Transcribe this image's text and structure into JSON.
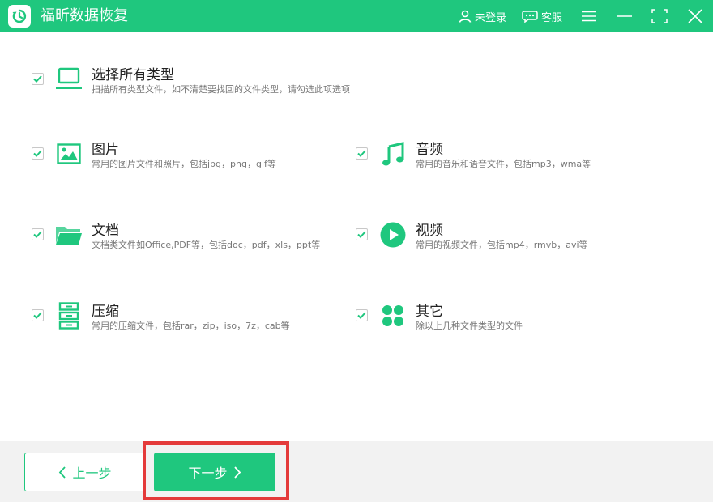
{
  "app": {
    "title": "福昕数据恢复"
  },
  "titlebar": {
    "login_label": "未登录",
    "service_label": "客服"
  },
  "options": {
    "all": {
      "title": "选择所有类型",
      "desc": "扫描所有类型文件，如不清楚要找回的文件类型，请勾选此项选项",
      "checked": true,
      "icon": "laptop-icon"
    },
    "image": {
      "title": "图片",
      "desc": "常用的图片文件和照片，包括jpg，png，gif等",
      "checked": true,
      "icon": "image-icon"
    },
    "audio": {
      "title": "音频",
      "desc": "常用的音乐和语音文件，包括mp3，wma等",
      "checked": true,
      "icon": "music-note-icon"
    },
    "document": {
      "title": "文档",
      "desc": "文档类文件如Office,PDF等，包括doc，pdf，xls，ppt等",
      "checked": true,
      "icon": "folder-icon"
    },
    "video": {
      "title": "视频",
      "desc": "常用的视频文件，包括mp4，rmvb，avi等",
      "checked": true,
      "icon": "play-icon"
    },
    "archive": {
      "title": "压缩",
      "desc": "常用的压缩文件，包括rar，zip，iso，7z，cab等",
      "checked": true,
      "icon": "archive-icon"
    },
    "other": {
      "title": "其它",
      "desc": "除以上几种文件类型的文件",
      "checked": true,
      "icon": "grid-dots-icon"
    }
  },
  "footer": {
    "prev_label": "上一步",
    "next_label": "下一步"
  },
  "colors": {
    "accent": "#1fc77e",
    "highlight": "#e43a3a"
  }
}
